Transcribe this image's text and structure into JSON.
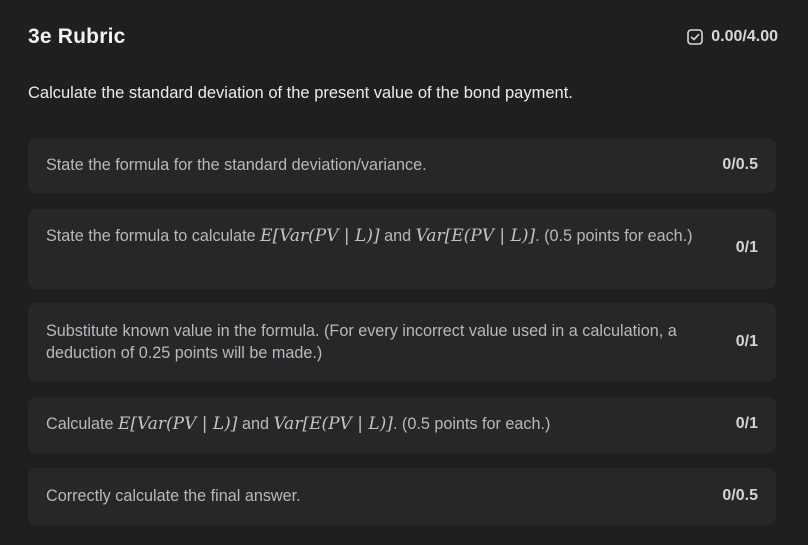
{
  "rubric": {
    "title": "3e Rubric",
    "score": "0.00/4.00",
    "question": "Calculate the standard deviation of the present value of the bond payment.",
    "items": [
      {
        "text_parts": [
          "State the formula for the standard deviation/variance."
        ],
        "points": "0/0.5"
      },
      {
        "text_a": "State the formula to calculate ",
        "math_a": "E[Var(PV | L)]",
        "text_b": " and ",
        "math_b": "Var[E(PV | L)]",
        "text_c": ". (0.5 points for each.)",
        "points": "0/1"
      },
      {
        "text_parts": [
          "Substitute known value in the formula. (For every incorrect value used in a calculation, a deduction of 0.25 points will be made.)"
        ],
        "points": "0/1"
      },
      {
        "text_a": "Calculate ",
        "math_a": "E[Var(PV | L)]",
        "text_b": " and ",
        "math_b": "Var[E(PV | L)]",
        "text_c": ". (0.5 points for each.)",
        "points": "0/1"
      },
      {
        "text_parts": [
          "Correctly calculate the final answer."
        ],
        "points": "0/0.5"
      }
    ]
  },
  "icons": {
    "score_icon": "checkbox-check-icon"
  },
  "colors": {
    "background": "#1f1f21",
    "card": "#27272a",
    "text_primary": "#ececec",
    "text_secondary": "#b9b9bc"
  }
}
